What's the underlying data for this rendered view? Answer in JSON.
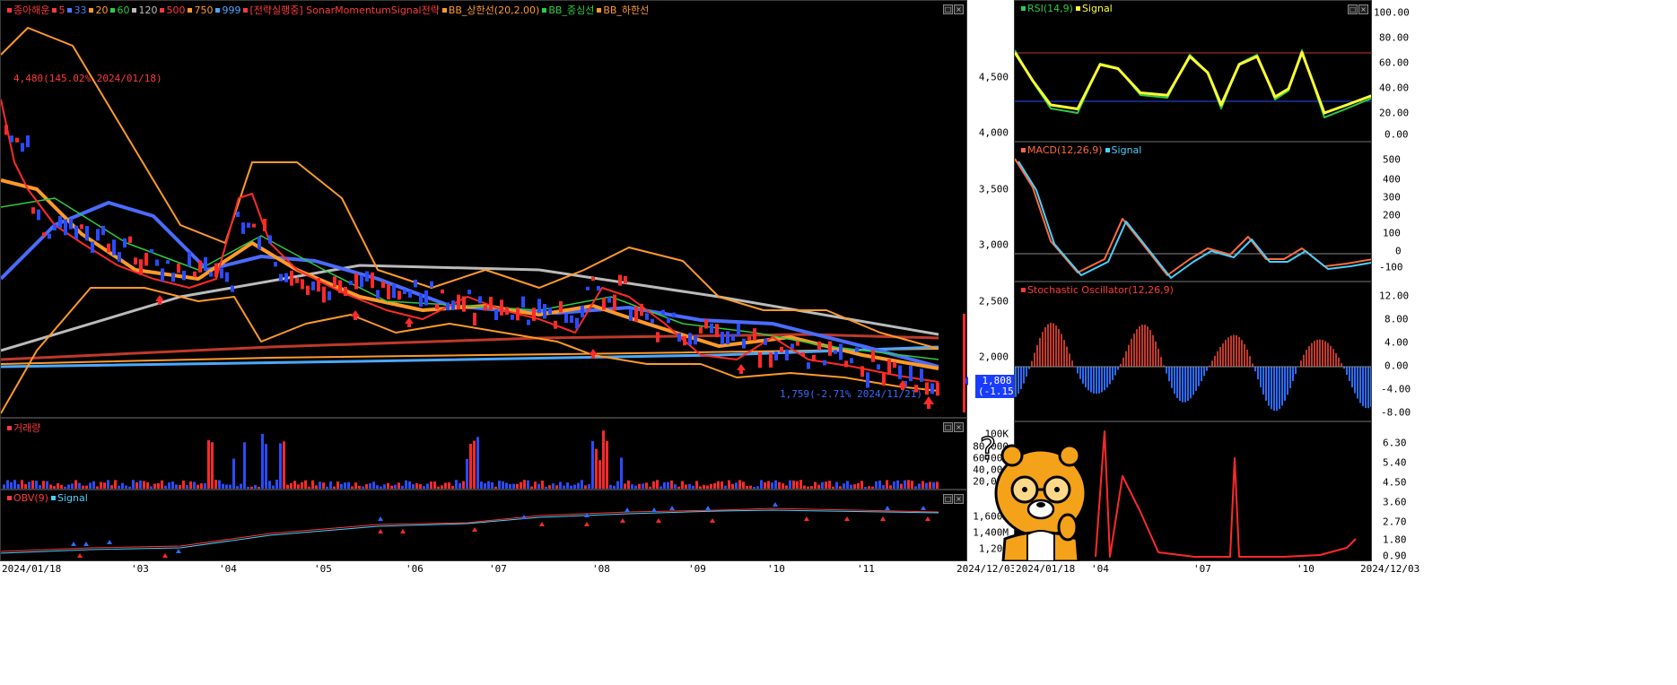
{
  "main_chart": {
    "legend": [
      {
        "label": "종아해운",
        "color": "#ff3a3a"
      },
      {
        "label": "5",
        "color": "#ff3a3a"
      },
      {
        "label": "33",
        "color": "#4a7cff"
      },
      {
        "label": "20",
        "color": "#ff9a2a"
      },
      {
        "label": "60",
        "color": "#2ecc40"
      },
      {
        "label": "120",
        "color": "#bbbbbb"
      },
      {
        "label": "500",
        "color": "#ff3a3a"
      },
      {
        "label": "750",
        "color": "#ff9a2a"
      },
      {
        "label": "999",
        "color": "#4aa8ff"
      },
      {
        "label": "[전략실행중] SonarMomentumSignal전략",
        "color": "#ff3a3a"
      },
      {
        "label": "BB_상한선(20,2.00)",
        "color": "#ff9a2a"
      },
      {
        "label": "BB_중심선",
        "color": "#2ecc40"
      },
      {
        "label": "BB_하한선",
        "color": "#ff9a2a"
      }
    ],
    "high_annotation": "4,480(145.02% 2024/01/18)",
    "low_annotation": "1,759(-2.71% 2024/11/21)",
    "current_price": "1,808",
    "current_change": "(-1.15%)",
    "y_ticks": [
      "4,500",
      "4,000",
      "3,500",
      "3,000",
      "2,500",
      "2,000"
    ]
  },
  "volume": {
    "title": "거래량",
    "y_ticks": [
      "100K",
      "80,000",
      "60,000",
      "40,000",
      "20,000"
    ]
  },
  "obv": {
    "title": "OBV(9)",
    "signal": "Signal",
    "y_ticks": [
      "1,600M",
      "1,400M",
      "1,200"
    ]
  },
  "x_axis_main": [
    "2024/01/18",
    "'03",
    "'04",
    "'05",
    "'06",
    "'07",
    "'08",
    "'09",
    "'10",
    "'11",
    "2024/12/03"
  ],
  "rsi": {
    "title": "RSI(14,9)",
    "signal": "Signal",
    "y_ticks": [
      "100.00",
      "80.00",
      "60.00",
      "40.00",
      "20.00",
      "0.00"
    ]
  },
  "macd": {
    "title": "MACD(12,26,9)",
    "signal": "Signal",
    "y_ticks": [
      "500",
      "400",
      "300",
      "200",
      "100",
      "0",
      "-100"
    ]
  },
  "stoch": {
    "title": "Stochastic Oscillator(12,26,9)",
    "y_ticks": [
      "12.00",
      "8.00",
      "4.00",
      "0.00",
      "-4.00",
      "-8.00"
    ]
  },
  "bottom_right": {
    "y_ticks": [
      "6.30",
      "5.40",
      "4.50",
      "3.60",
      "2.70",
      "1.80",
      "0.90"
    ]
  },
  "x_axis_right": [
    "2024/01/18",
    "'04",
    "'07",
    "'10",
    "2024/12/03"
  ],
  "window_buttons": {
    "min": "□",
    "close": "×"
  },
  "colors": {
    "up": "#ff2a2a",
    "down": "#2a4cff"
  }
}
